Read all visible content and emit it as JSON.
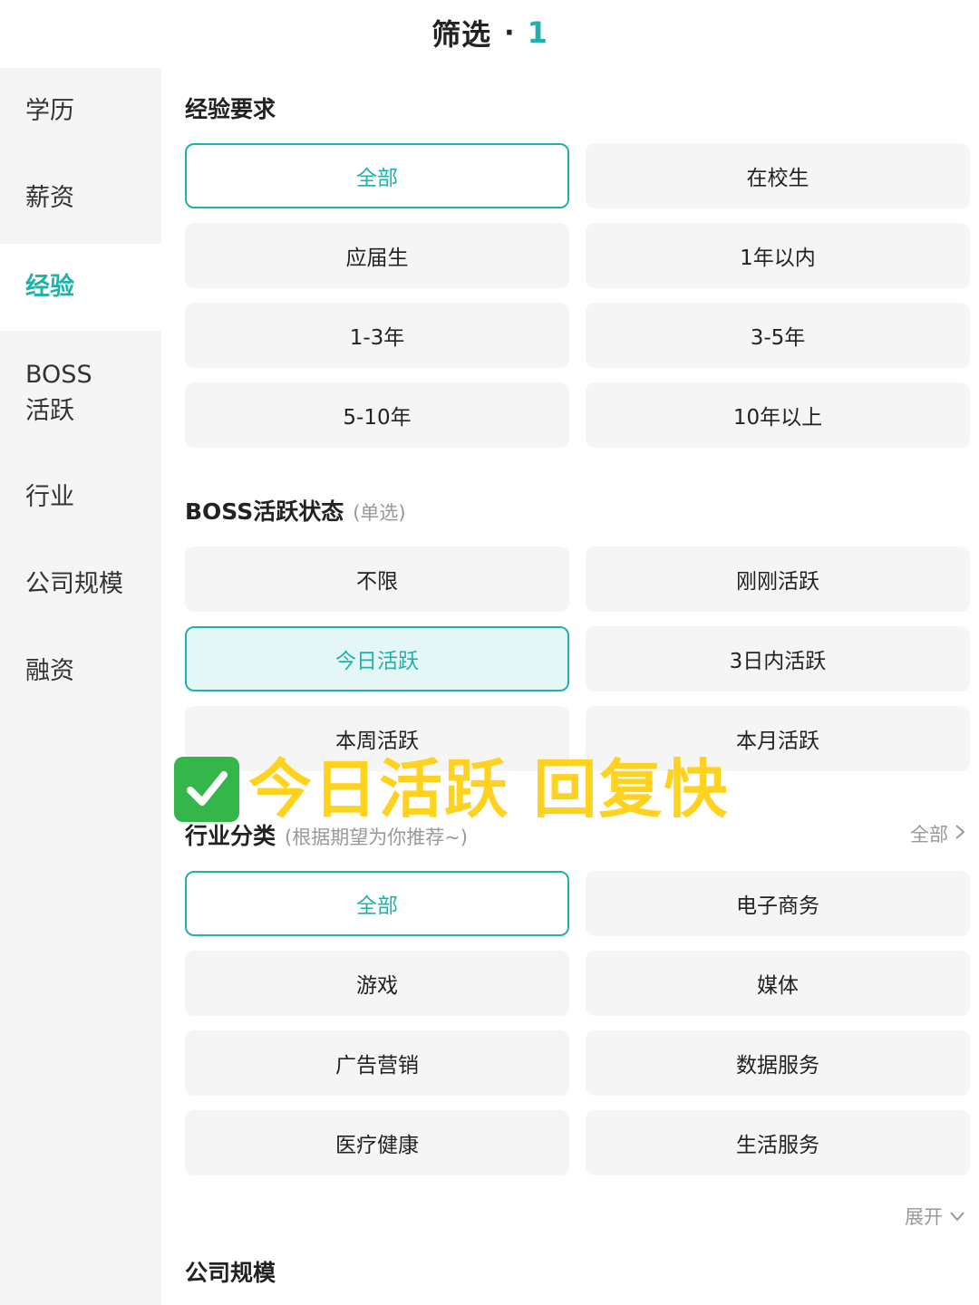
{
  "header": {
    "title": "筛选",
    "dot": "·",
    "count": "1"
  },
  "sidebar": {
    "items": [
      {
        "label": "学历"
      },
      {
        "label": "薪资"
      },
      {
        "label": "经验"
      },
      {
        "label": "BOSS\n活跃"
      },
      {
        "label": "行业"
      },
      {
        "label": "公司规模"
      },
      {
        "label": "融资"
      }
    ],
    "active": "经验"
  },
  "experience": {
    "title": "经验要求",
    "options": [
      "全部",
      "在校生",
      "应届生",
      "1年以内",
      "1-3年",
      "3-5年",
      "5-10年",
      "10年以上"
    ],
    "selected": "全部"
  },
  "boss_status": {
    "title": "BOSS活跃状态",
    "subtitle": "(单选)",
    "options": [
      "不限",
      "刚刚活跃",
      "今日活跃",
      "3日内活跃",
      "本周活跃",
      "本月活跃"
    ],
    "selected": "今日活跃"
  },
  "industry": {
    "title": "行业分类",
    "subtitle": "(根据期望为你推荐~)",
    "more_label": "全部",
    "options": [
      "全部",
      "电子商务",
      "游戏",
      "媒体",
      "广告营销",
      "数据服务",
      "医疗健康",
      "生活服务"
    ],
    "selected": "全部",
    "expand_label": "展开"
  },
  "company_size": {
    "title": "公司规模"
  },
  "overlay": {
    "text": "今日活跃 回复快",
    "icon": "check-mark-icon"
  },
  "colors": {
    "accent": "#1fb2aa",
    "selected_fill": "#e5f6f6",
    "option_bg": "#f5f5f5",
    "overlay_text": "#ffd21f",
    "check_green": "#35b64a"
  }
}
